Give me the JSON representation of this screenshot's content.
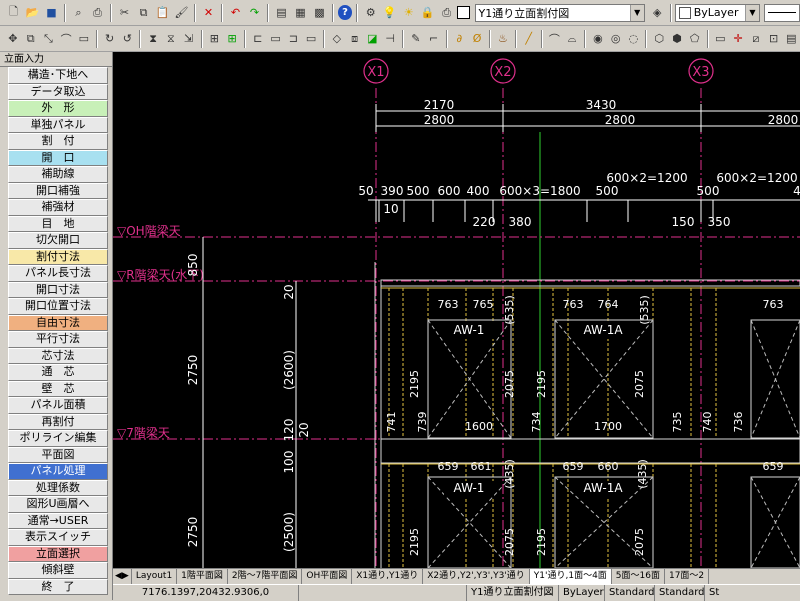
{
  "toolbar": {
    "view_combo": "Y1通り立面割付図",
    "layer_combo": "ByLayer"
  },
  "panel": {
    "title": "立面入力",
    "items": [
      {
        "label": "構造･下地へ",
        "color": "#e8e8e8"
      },
      {
        "label": "データ取込",
        "color": "#e8e8e8"
      },
      {
        "label": "外　形",
        "color": "#c8f0b8"
      },
      {
        "label": "単独パネル",
        "color": "#e8e8e8"
      },
      {
        "label": "割　付",
        "color": "#e8e8e8"
      },
      {
        "label": "開　口",
        "color": "#a8e0f0"
      },
      {
        "label": "補助線",
        "color": "#e8e8e8"
      },
      {
        "label": "開口補強",
        "color": "#e8e8e8"
      },
      {
        "label": "補強材",
        "color": "#e8e8e8"
      },
      {
        "label": "目　地",
        "color": "#e8e8e8"
      },
      {
        "label": "切欠開口",
        "color": "#e8e8e8"
      },
      {
        "label": "割付寸法",
        "color": "#f8e8a8"
      },
      {
        "label": "パネル長寸法",
        "color": "#e8e8e8"
      },
      {
        "label": "開口寸法",
        "color": "#e8e8e8"
      },
      {
        "label": "開口位置寸法",
        "color": "#e8e8e8"
      },
      {
        "label": "自由寸法",
        "color": "#f0b080"
      },
      {
        "label": "平行寸法",
        "color": "#e8e8e8"
      },
      {
        "label": "芯寸法",
        "color": "#e8e8e8"
      },
      {
        "label": "通　芯",
        "color": "#e8e8e8"
      },
      {
        "label": "壁　芯",
        "color": "#e8e8e8"
      },
      {
        "label": "パネル面積",
        "color": "#e8e8e8"
      },
      {
        "label": "再割付",
        "color": "#e8e8e8"
      },
      {
        "label": "ポリライン編集",
        "color": "#e8e8e8"
      },
      {
        "label": "平面図",
        "color": "#e8e8e8"
      },
      {
        "label": "パネル処理",
        "color": "#4070d0"
      },
      {
        "label": "処理係数",
        "color": "#e8e8e8"
      },
      {
        "label": "図形U画層へ",
        "color": "#e8e8e8"
      },
      {
        "label": "通常→USER",
        "color": "#e8e8e8"
      },
      {
        "label": "表示スイッチ",
        "color": "#e8e8e8"
      },
      {
        "label": "立面選択",
        "color": "#f0a0a0"
      },
      {
        "label": "傾斜壁",
        "color": "#e8e8e8"
      },
      {
        "label": "終　了",
        "color": "#e8e8e8"
      }
    ]
  },
  "drawing": {
    "axes": [
      "X1",
      "X2",
      "X3"
    ],
    "dims_top": [
      "2170",
      "3430",
      "2800",
      "2800",
      "2800"
    ],
    "dims_row3": [
      "50",
      "390",
      "500",
      "600",
      "400",
      "600×3=1800",
      "500",
      "600×2=1200",
      "500",
      "600×2=1200",
      "4"
    ],
    "dims_small": [
      "10",
      "220",
      "380",
      "150",
      "350"
    ],
    "levels": [
      "▽OH階梁天",
      "▽R階梁天(水下)",
      "▽7階梁天"
    ],
    "left_dims": [
      "850",
      "2750",
      "2750",
      "20",
      "(2600)",
      "120",
      "100",
      "20",
      "(2500)"
    ],
    "windows": [
      "AW-1",
      "AW-1A",
      "AW-1",
      "AW-1A"
    ],
    "window_dims": [
      "763",
      "765",
      "(535)",
      "763",
      "764",
      "(535)",
      "763",
      "2195",
      "2075",
      "2195",
      "2075",
      "1600",
      "1700",
      "741",
      "739",
      "734",
      "735",
      "740",
      "736",
      "659",
      "661",
      "(435)",
      "659",
      "660",
      "(435)",
      "659",
      "2195",
      "2075",
      "2195",
      "2075"
    ]
  },
  "tabs": [
    "Layout1",
    "1階平面図",
    "2階〜7階平面図",
    "OH平面図",
    "X1通り,Y1通り",
    "X2通り,Y2',Y3',Y3'通り",
    "Y1'通り,1面〜4面",
    "5面〜16面",
    "17面〜2"
  ],
  "status": {
    "coords": "7176.1397,20432.9306,0",
    "view": "Y1通り立面割付図",
    "layer": "ByLayer",
    "style1": "Standard",
    "style2": "Standard",
    "extra": "St"
  }
}
